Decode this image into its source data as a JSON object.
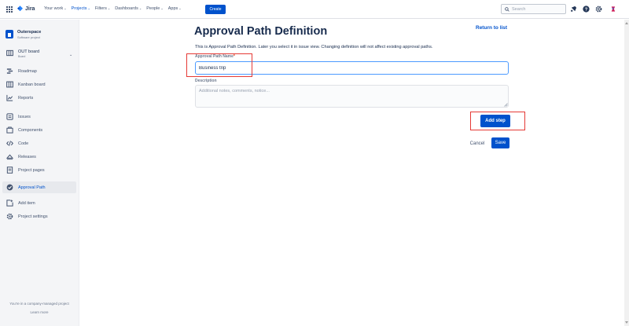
{
  "topnav": {
    "logo_text": "Jira",
    "items": [
      {
        "label": "Your work",
        "active": false
      },
      {
        "label": "Projects",
        "active": true
      },
      {
        "label": "Filters",
        "active": false
      },
      {
        "label": "Dashboards",
        "active": false
      },
      {
        "label": "People",
        "active": false
      },
      {
        "label": "Apps",
        "active": false
      }
    ],
    "create_label": "Create",
    "search_placeholder": "Search",
    "icons": [
      "notifications-icon",
      "help-icon",
      "settings-icon",
      "user-avatar-icon"
    ]
  },
  "sidebar": {
    "project_name": "Outerspace",
    "project_type": "Software project",
    "board_name": "OUT board",
    "board_sub": "Board",
    "items": [
      {
        "label": "Roadmap",
        "icon": "roadmap-icon"
      },
      {
        "label": "Kanban board",
        "icon": "kanban-icon"
      },
      {
        "label": "Reports",
        "icon": "reports-icon"
      },
      {
        "label": "Issues",
        "icon": "issues-icon"
      },
      {
        "label": "Components",
        "icon": "components-icon"
      },
      {
        "label": "Code",
        "icon": "code-icon"
      },
      {
        "label": "Releases",
        "icon": "releases-icon"
      },
      {
        "label": "Project pages",
        "icon": "pages-icon"
      },
      {
        "label": "Approval Path",
        "icon": "approval-path-icon",
        "active": true
      },
      {
        "label": "Add item",
        "icon": "add-item-icon"
      },
      {
        "label": "Project settings",
        "icon": "settings-icon"
      }
    ],
    "footer_text": "You're in a company-managed project",
    "footer_link": "Learn more"
  },
  "main": {
    "title": "Approval Path Definition",
    "return_link": "Return to list",
    "description": "This is Approval Path Definition. Later you select it in issue view. Changing definition will not affect existing approval paths.",
    "name_label": "Approval Path Name",
    "required_mark": "*",
    "name_value": "Business trip",
    "desc_label": "Description",
    "desc_placeholder": "Additional notes, comments, notice...",
    "add_step_label": "Add step",
    "cancel_label": "Cancel",
    "save_label": "Save"
  },
  "colors": {
    "primary": "#0052cc",
    "highlight": "#e53935",
    "sidebar_bg": "#f4f5f7",
    "text": "#172b4d"
  }
}
